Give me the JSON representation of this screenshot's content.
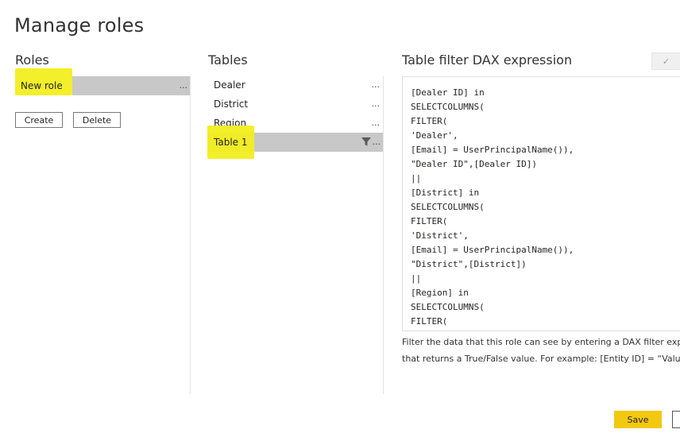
{
  "dialog": {
    "title": "Manage roles"
  },
  "roles": {
    "heading": "Roles",
    "items": [
      {
        "label": "New role",
        "more": "..."
      }
    ],
    "create_label": "Create",
    "delete_label": "Delete"
  },
  "tables": {
    "heading": "Tables",
    "items": [
      {
        "label": "Dealer",
        "more": "..."
      },
      {
        "label": "District",
        "more": "..."
      },
      {
        "label": "Region",
        "more": "..."
      },
      {
        "label": "Table 1",
        "more": "..."
      }
    ]
  },
  "editor": {
    "heading": "Table filter DAX expression",
    "check_glyph": "✓",
    "lines": [
      "[Dealer ID] in",
      "SELECTCOLUMNS(",
      "FILTER(",
      "'Dealer',",
      "[Email] = UserPrincipalName()),",
      "\"Dealer ID\",[Dealer ID])",
      "||",
      "[District] in",
      "SELECTCOLUMNS(",
      "FILTER(",
      "'District',",
      "[Email] = UserPrincipalName()),",
      "\"District\",[District])",
      "||",
      "[Region] in",
      "SELECTCOLUMNS(",
      "FILTER("
    ],
    "help_line1": "Filter the data that this role can see by entering a DAX filter expression",
    "help_line2": "that returns a True/False value. For example: [Entity ID] = “Value”"
  },
  "footer": {
    "save_label": "Save"
  },
  "colors": {
    "highlight": "#f2ee1f",
    "selected_row": "#c8c8c8",
    "save_button": "#f2c811"
  }
}
